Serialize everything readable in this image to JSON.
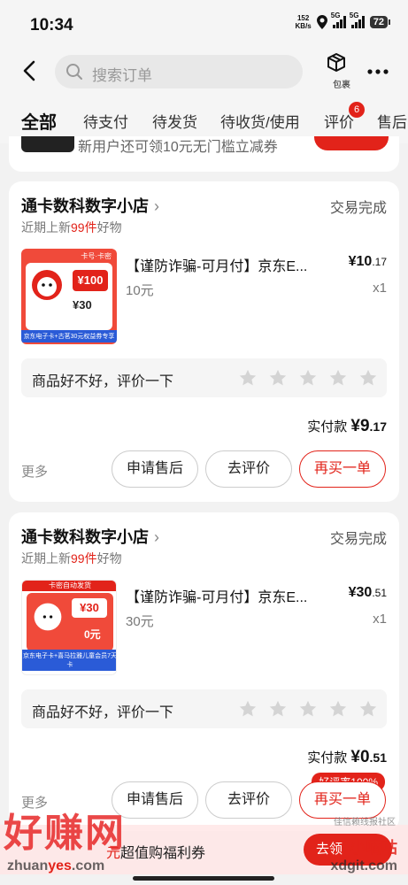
{
  "status_bar": {
    "time": "10:34",
    "net_speed_top": "152",
    "net_speed_bottom": "KB/s",
    "sim1": "5G",
    "sim2": "5G",
    "battery": "72"
  },
  "header": {
    "search_placeholder": "搜索订单",
    "package_label": "包裹"
  },
  "tabs": [
    {
      "label": "全部",
      "active": true
    },
    {
      "label": "待支付"
    },
    {
      "label": "待发货"
    },
    {
      "label": "待收货/使用"
    },
    {
      "label": "评价",
      "badge": "6"
    },
    {
      "label": "售后"
    }
  ],
  "top_card_text": "新用户还可领10元无门槛立减券",
  "orders": [
    {
      "shop": "通卡数科数字小店",
      "status": "交易完成",
      "sub_prefix": "近期上新",
      "sub_count": "99件",
      "sub_suffix": "好物",
      "product_title": "【谨防诈骗-可月付】京东E...",
      "price_int": "¥10",
      "price_dec": ".17",
      "spec": "10元",
      "qty": "x1",
      "rate_prompt": "商品好不好，评价一下",
      "paid_label": "实付款",
      "paid_int": "¥9",
      "paid_dec": ".17",
      "more": "更多",
      "btn_aftersale": "申请售后",
      "btn_review": "去评价",
      "btn_rebuy": "再买一单",
      "thumb": {
        "tag": "卡号·卡密",
        "amount": "100",
        "coupon": "30",
        "caption": "京东电子卡+古茗30元权益券专享"
      }
    },
    {
      "shop": "通卡数科数字小店",
      "status": "交易完成",
      "sub_prefix": "近期上新",
      "sub_count": "99件",
      "sub_suffix": "好物",
      "product_title": "【谨防诈骗-可月付】京东E...",
      "price_int": "¥30",
      "price_dec": ".51",
      "spec": "30元",
      "qty": "x1",
      "rate_prompt": "商品好不好，评价一下",
      "paid_label": "实付款",
      "paid_int": "¥0",
      "paid_dec": ".51",
      "more": "更多",
      "btn_aftersale": "申请售后",
      "btn_review": "去评价",
      "btn_rebuy": "再买一单",
      "good_rate": "好评率100%",
      "thumb": {
        "tag": "卡密自动发货",
        "amount": "30",
        "coupon": "0元",
        "caption": "京东电子卡+喜马拉雅儿童会员7天卡"
      }
    }
  ],
  "banner": {
    "text_red": "元",
    "text": "超值购福利券",
    "go": "去领"
  },
  "watermark": {
    "main": "好赚网",
    "url_a": "zhuan",
    "url_b": "yes",
    "url_c": ".com",
    "right_red": "小嘀咕",
    "right": "xdgit.com",
    "right_small": "佳信赖线报社区"
  },
  "colors": {
    "brand_red": "#e2231a",
    "background": "#f2f2f2"
  }
}
